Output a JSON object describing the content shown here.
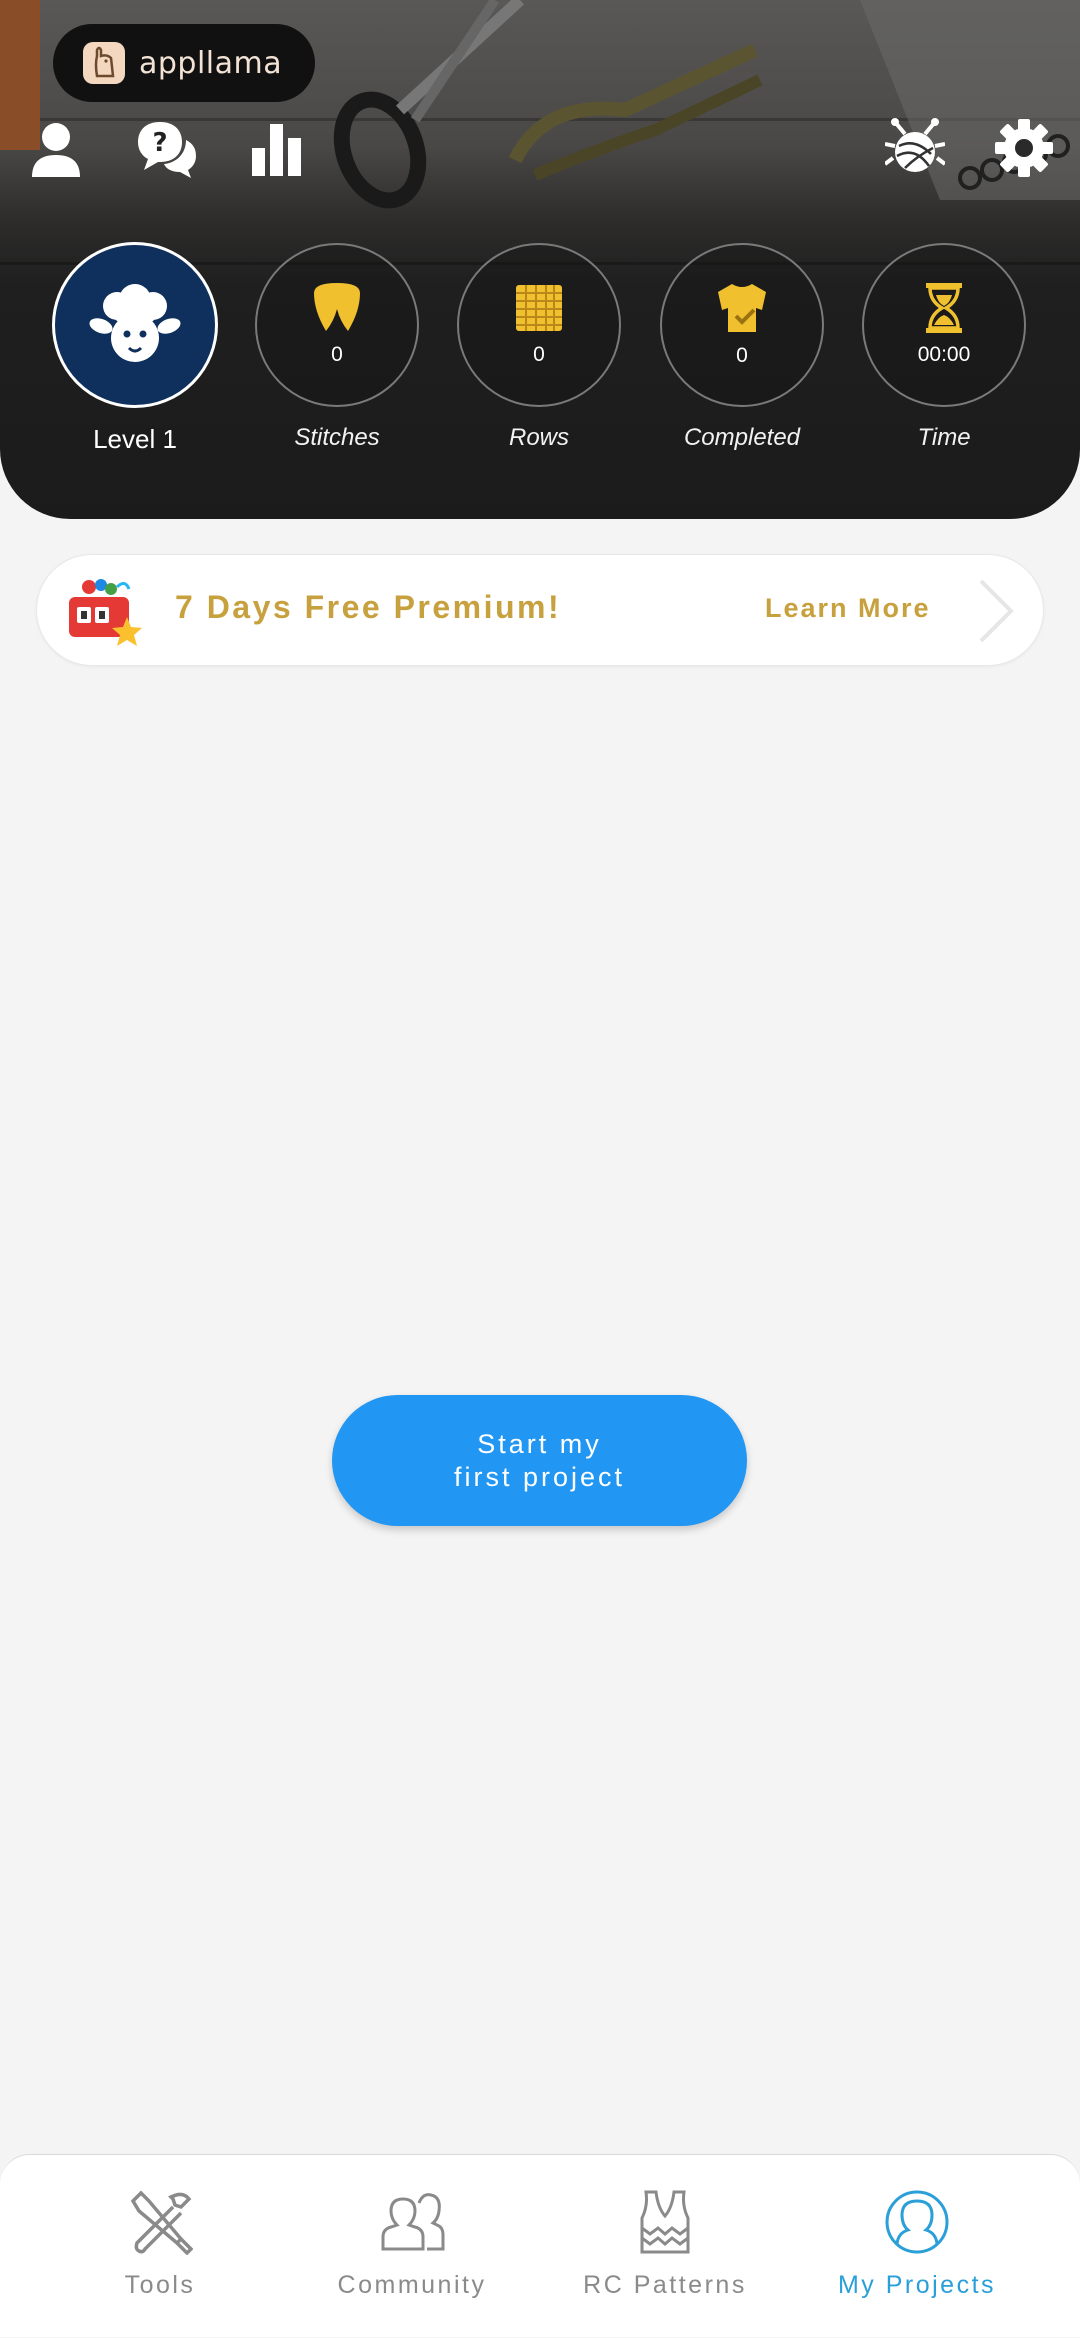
{
  "app": {
    "brand": "appllama"
  },
  "header": {
    "icons": [
      "profile-icon",
      "help-chat-icon",
      "stats-icon",
      "yarn-bug-icon",
      "gear-icon"
    ]
  },
  "stats": {
    "level": {
      "label": "Level 1",
      "icon": "sheep-icon"
    },
    "items": [
      {
        "label": "Stitches",
        "value": "0",
        "icon": "stitch-icon"
      },
      {
        "label": "Rows",
        "value": "0",
        "icon": "rows-icon"
      },
      {
        "label": "Completed",
        "value": "0",
        "icon": "sweater-check-icon"
      },
      {
        "label": "Time",
        "value": "00:00",
        "icon": "hourglass-icon"
      }
    ],
    "accent": "#f0c02e",
    "level_bg": "#0f2f5c"
  },
  "promo": {
    "title": "7 Days Free Premium!",
    "link": "Learn More",
    "icon": "gift-counter-icon",
    "accent": "#c8a13f"
  },
  "cta": {
    "line1": "Start my",
    "line2": "first project",
    "color": "#2196f3"
  },
  "nav": {
    "items": [
      {
        "label": "Tools",
        "icon": "tools-icon"
      },
      {
        "label": "Community",
        "icon": "community-icon"
      },
      {
        "label": "RC Patterns",
        "icon": "pattern-vest-icon"
      },
      {
        "label": "My Projects",
        "icon": "my-projects-icon"
      }
    ],
    "active": "My Projects",
    "active_color": "#2a9fd8"
  }
}
